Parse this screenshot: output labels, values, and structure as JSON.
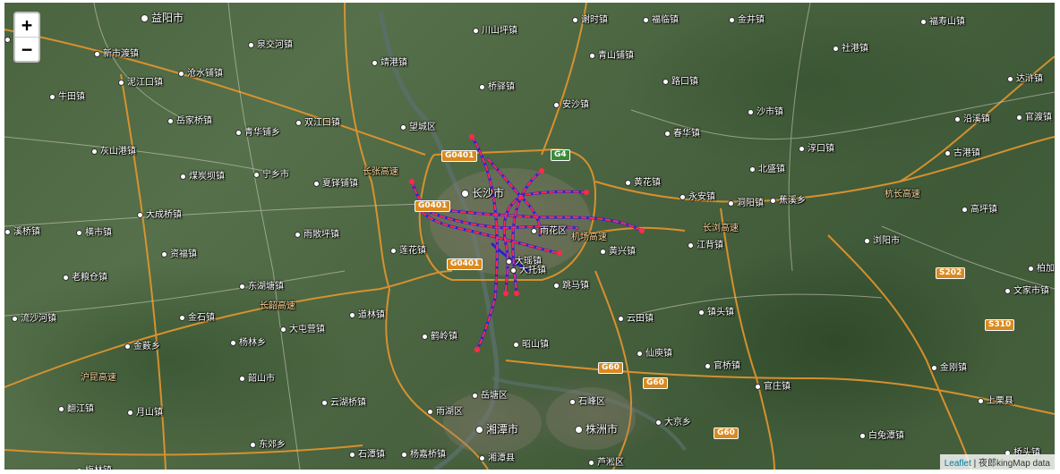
{
  "zoom": {
    "in_label": "+",
    "out_label": "−"
  },
  "attribution": {
    "link_label": "Leaflet",
    "separator": "|",
    "data_label": "夜郎kingMap data"
  },
  "places": [
    {
      "name": "益阳市",
      "big": true
    },
    {
      "name": "江县",
      "big": false
    },
    {
      "name": "新市渡镇",
      "big": false
    },
    {
      "name": "泉交河镇",
      "big": false
    },
    {
      "name": "靖港镇",
      "big": false
    },
    {
      "name": "川山坪镇",
      "big": false
    },
    {
      "name": "谢时镇",
      "big": false
    },
    {
      "name": "福临镇",
      "big": false
    },
    {
      "name": "金井镇",
      "big": false
    },
    {
      "name": "福寿山镇",
      "big": false
    },
    {
      "name": "泥江口镇",
      "big": false
    },
    {
      "name": "沧水铺镇",
      "big": false
    },
    {
      "name": "青山铺镇",
      "big": false
    },
    {
      "name": "社港镇",
      "big": false
    },
    {
      "name": "牛田镇",
      "big": false
    },
    {
      "name": "桥驿镇",
      "big": false
    },
    {
      "name": "路口镇",
      "big": false
    },
    {
      "name": "达浒镇",
      "big": false
    },
    {
      "name": "岳家桥镇",
      "big": false
    },
    {
      "name": "双江口镇",
      "big": false
    },
    {
      "name": "望城区",
      "big": false
    },
    {
      "name": "安沙镇",
      "big": false
    },
    {
      "name": "沙市镇",
      "big": false
    },
    {
      "name": "沿溪镇",
      "big": false
    },
    {
      "name": "官渡镇",
      "big": false
    },
    {
      "name": "青华铺乡",
      "big": false
    },
    {
      "name": "春华镇",
      "big": false
    },
    {
      "name": "灰山港镇",
      "big": false
    },
    {
      "name": "淳口镇",
      "big": false
    },
    {
      "name": "古港镇",
      "big": false
    },
    {
      "name": "煤炭坝镇",
      "big": false
    },
    {
      "name": "宁乡市",
      "big": false
    },
    {
      "name": "夏铎铺镇",
      "big": false
    },
    {
      "name": "黄花镇",
      "big": false
    },
    {
      "name": "北盛镇",
      "big": false
    },
    {
      "name": "长沙市",
      "big": true
    },
    {
      "name": "永安镇",
      "big": false
    },
    {
      "name": "洞阳镇",
      "big": false
    },
    {
      "name": "蕉溪乡",
      "big": false
    },
    {
      "name": "高坪镇",
      "big": false
    },
    {
      "name": "大成桥镇",
      "big": false
    },
    {
      "name": "溪桥镇",
      "big": false
    },
    {
      "name": "横市镇",
      "big": false
    },
    {
      "name": "雨敞坪镇",
      "big": false
    },
    {
      "name": "江背镇",
      "big": false
    },
    {
      "name": "浏阳市",
      "big": false
    },
    {
      "name": "资福镇",
      "big": false
    },
    {
      "name": "莲花镇",
      "big": false
    },
    {
      "name": "黄兴镇",
      "big": false
    },
    {
      "name": "老粮仓镇",
      "big": false
    },
    {
      "name": "东湖塘镇",
      "big": false
    },
    {
      "name": "跳马镇",
      "big": false
    },
    {
      "name": "柏加镇",
      "big": false
    },
    {
      "name": "文家市镇",
      "big": false
    },
    {
      "name": "金石镇",
      "big": false
    },
    {
      "name": "道林镇",
      "big": false
    },
    {
      "name": "云田镇",
      "big": false
    },
    {
      "name": "镇头镇",
      "big": false
    },
    {
      "name": "流沙河镇",
      "big": false
    },
    {
      "name": "大屯营镇",
      "big": false
    },
    {
      "name": "鹤岭镇",
      "big": false
    },
    {
      "name": "大瑶镇",
      "big": false
    },
    {
      "name": "杨林乡",
      "big": false
    },
    {
      "name": "金薮乡",
      "big": false
    },
    {
      "name": "昭山镇",
      "big": false
    },
    {
      "name": "仙庾镇",
      "big": false
    },
    {
      "name": "官桥镇",
      "big": false
    },
    {
      "name": "金刚镇",
      "big": false
    },
    {
      "name": "韶山市",
      "big": false
    },
    {
      "name": "岳塘区",
      "big": false
    },
    {
      "name": "石峰区",
      "big": false
    },
    {
      "name": "官庄镇",
      "big": false
    },
    {
      "name": "上栗县",
      "big": false
    },
    {
      "name": "翻江镇",
      "big": false
    },
    {
      "name": "云湖桥镇",
      "big": false
    },
    {
      "name": "雨湖区",
      "big": false
    },
    {
      "name": "湘潭市",
      "big": true
    },
    {
      "name": "株洲市",
      "big": true
    },
    {
      "name": "大京乡",
      "big": false
    },
    {
      "name": "白兔潭镇",
      "big": false
    },
    {
      "name": "月山镇",
      "big": false
    },
    {
      "name": "东郊乡",
      "big": false
    },
    {
      "name": "石潭镇",
      "big": false
    },
    {
      "name": "杨嘉桥镇",
      "big": false
    },
    {
      "name": "湘潭县",
      "big": false
    },
    {
      "name": "芦淞区",
      "big": false
    },
    {
      "name": "桥头镇",
      "big": false
    },
    {
      "name": "梅林镇",
      "big": false
    },
    {
      "name": "雨花区",
      "big": false
    },
    {
      "name": "大托镇",
      "big": false
    }
  ],
  "roads": [
    {
      "ref": "G0401"
    },
    {
      "ref": "G4"
    },
    {
      "ref": "G0401"
    },
    {
      "ref": "G0401"
    },
    {
      "ref": "G60"
    },
    {
      "ref": "G60"
    },
    {
      "ref": "G60"
    },
    {
      "ref": "S202"
    },
    {
      "ref": "S310"
    }
  ],
  "road_names": [
    {
      "name": "长张高速"
    },
    {
      "name": "杭长高速"
    },
    {
      "name": "机场高速"
    },
    {
      "name": "长韶高速"
    },
    {
      "name": "长浏高速"
    },
    {
      "name": "沪昆高速"
    }
  ]
}
